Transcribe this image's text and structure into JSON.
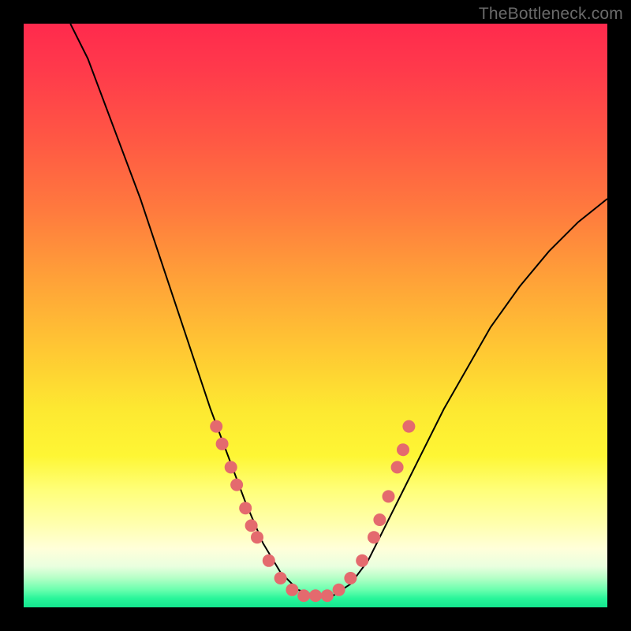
{
  "watermark": {
    "text": "TheBottleneck.com"
  },
  "chart_data": {
    "type": "line",
    "title": "",
    "xlabel": "",
    "ylabel": "",
    "xlim": [
      0,
      100
    ],
    "ylim": [
      0,
      100
    ],
    "grid": false,
    "legend": false,
    "series": [
      {
        "name": "bottleneck-curve",
        "stroke": "#000000",
        "points": [
          {
            "x": 8,
            "y": 100
          },
          {
            "x": 11,
            "y": 94
          },
          {
            "x": 14,
            "y": 86
          },
          {
            "x": 17,
            "y": 78
          },
          {
            "x": 20,
            "y": 70
          },
          {
            "x": 23,
            "y": 61
          },
          {
            "x": 26,
            "y": 52
          },
          {
            "x": 29,
            "y": 43
          },
          {
            "x": 32,
            "y": 34
          },
          {
            "x": 35,
            "y": 26
          },
          {
            "x": 38,
            "y": 18
          },
          {
            "x": 41,
            "y": 11
          },
          {
            "x": 44,
            "y": 6
          },
          {
            "x": 47,
            "y": 3
          },
          {
            "x": 50,
            "y": 2
          },
          {
            "x": 53,
            "y": 2
          },
          {
            "x": 56,
            "y": 4
          },
          {
            "x": 59,
            "y": 8
          },
          {
            "x": 62,
            "y": 14
          },
          {
            "x": 65,
            "y": 20
          },
          {
            "x": 68,
            "y": 26
          },
          {
            "x": 72,
            "y": 34
          },
          {
            "x": 76,
            "y": 41
          },
          {
            "x": 80,
            "y": 48
          },
          {
            "x": 85,
            "y": 55
          },
          {
            "x": 90,
            "y": 61
          },
          {
            "x": 95,
            "y": 66
          },
          {
            "x": 100,
            "y": 70
          }
        ]
      },
      {
        "name": "left-markers",
        "fill": "#e46a6e",
        "points": [
          {
            "x": 33,
            "y": 31
          },
          {
            "x": 34,
            "y": 28
          },
          {
            "x": 35.5,
            "y": 24
          },
          {
            "x": 36.5,
            "y": 21
          },
          {
            "x": 38,
            "y": 17
          },
          {
            "x": 39,
            "y": 14
          },
          {
            "x": 40,
            "y": 12
          },
          {
            "x": 42,
            "y": 8
          },
          {
            "x": 44,
            "y": 5
          },
          {
            "x": 46,
            "y": 3
          },
          {
            "x": 48,
            "y": 2
          },
          {
            "x": 50,
            "y": 2
          },
          {
            "x": 52,
            "y": 2
          }
        ]
      },
      {
        "name": "right-markers",
        "fill": "#e46a6e",
        "points": [
          {
            "x": 54,
            "y": 3
          },
          {
            "x": 56,
            "y": 5
          },
          {
            "x": 58,
            "y": 8
          },
          {
            "x": 60,
            "y": 12
          },
          {
            "x": 61,
            "y": 15
          },
          {
            "x": 62.5,
            "y": 19
          },
          {
            "x": 64,
            "y": 24
          },
          {
            "x": 65,
            "y": 27
          },
          {
            "x": 66,
            "y": 31
          }
        ]
      }
    ],
    "background_gradient": {
      "top": "#ff2a4d",
      "mid": "#fde831",
      "bottom": "#14e68e"
    }
  }
}
